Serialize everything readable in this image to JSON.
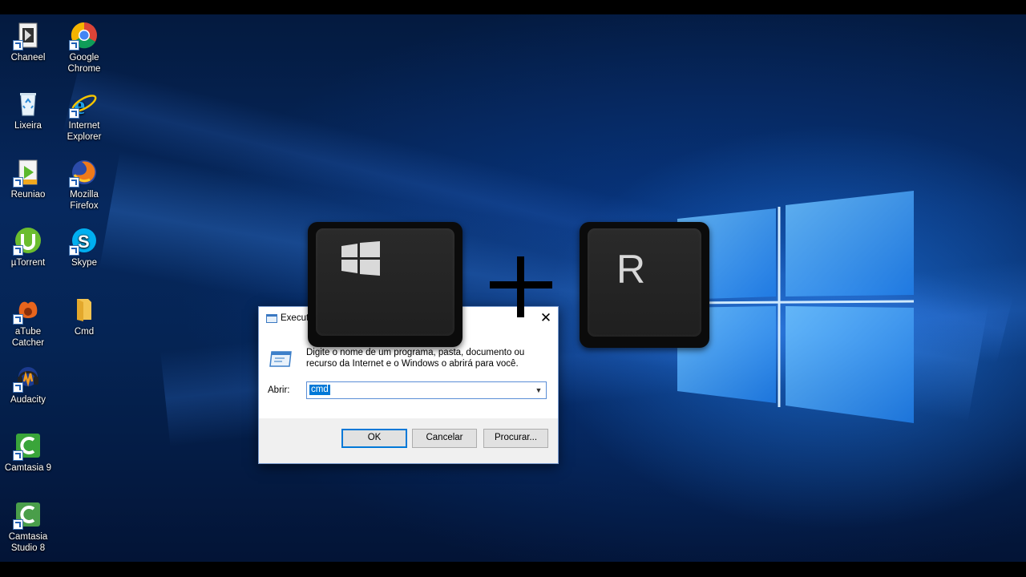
{
  "desktop_icons": [
    {
      "label": "Chaneel",
      "icon": "app-icon"
    },
    {
      "label": "Google\nChrome",
      "icon": "chrome-icon"
    },
    {
      "label": "Lixeira",
      "icon": "recycle-bin-icon"
    },
    {
      "label": "Internet\nExplorer",
      "icon": "internet-explorer-icon"
    },
    {
      "label": "Reuniao",
      "icon": "media-file-icon"
    },
    {
      "label": "Mozilla\nFirefox",
      "icon": "firefox-icon"
    },
    {
      "label": "µTorrent",
      "icon": "utorrent-icon"
    },
    {
      "label": "Skype",
      "icon": "skype-icon"
    },
    {
      "label": "aTube\nCatcher",
      "icon": "atube-catcher-icon"
    },
    {
      "label": "Cmd",
      "icon": "folder-icon"
    },
    {
      "label": "Audacity",
      "icon": "audacity-icon"
    },
    {
      "label": "Camtasia 9",
      "icon": "camtasia-icon"
    },
    {
      "label": "Camtasia\nStudio 8",
      "icon": "camtasia-icon"
    }
  ],
  "run_dialog": {
    "title": "Executar",
    "close_glyph": "✕",
    "description": "Digite o nome de um programa, pasta, documento ou recurso da Internet e o Windows o abrirá para você.",
    "open_label": "Abrir:",
    "open_value": "cmd",
    "ok_label": "OK",
    "cancel_label": "Cancelar",
    "browse_label": "Procurar..."
  },
  "overlay": {
    "second_key": "R",
    "colors": {
      "key": "#0b0b0b",
      "accent": "#0078d7"
    }
  }
}
